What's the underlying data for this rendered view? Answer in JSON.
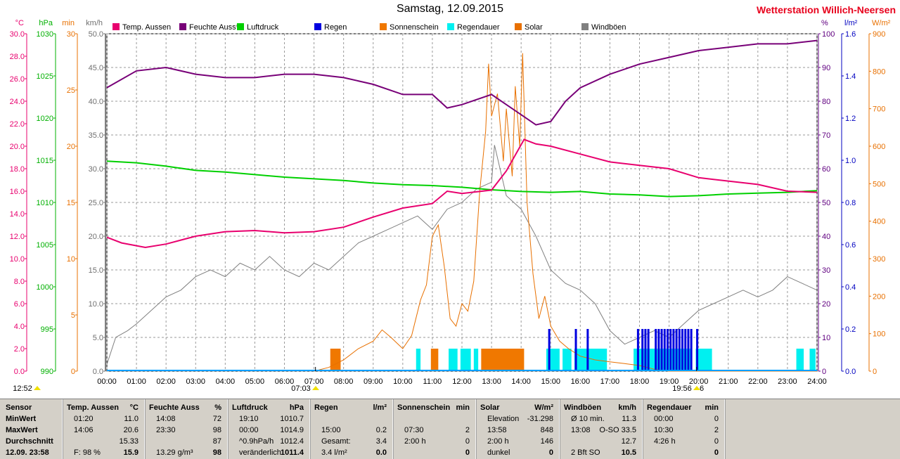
{
  "page": {
    "title": "Samstag, 12.09.2015",
    "station": "Wetterstation Willich-Neersen"
  },
  "chart_data": {
    "type": "line",
    "x_ticks": [
      "00:00",
      "01:00",
      "02:00",
      "03:00",
      "04:00",
      "05:00",
      "06:00",
      "07:00",
      "08:00",
      "09:00",
      "10:00",
      "11:00",
      "12:00",
      "13:00",
      "14:00",
      "15:00",
      "16:00",
      "17:00",
      "18:00",
      "19:00",
      "20:00",
      "21:00",
      "22:00",
      "23:00",
      "24:00"
    ],
    "x_range": [
      0,
      24
    ],
    "grid": true,
    "legend_placement": "top",
    "left_axes": [
      {
        "unit": "°C",
        "color": "#e8006e",
        "range": [
          0,
          30
        ],
        "ticks": [
          "0.0",
          "2.0",
          "4.0",
          "6.0",
          "8.0",
          "10.0",
          "12.0",
          "14.0",
          "16.0",
          "18.0",
          "20.0",
          "22.0",
          "24.0",
          "26.0",
          "28.0",
          "30.0"
        ]
      },
      {
        "unit": "hPa",
        "color": "#00b000",
        "range": [
          990,
          1030
        ],
        "ticks": [
          "990",
          "995",
          "1000",
          "1005",
          "1010",
          "1015",
          "1020",
          "1025",
          "1030"
        ]
      },
      {
        "unit": "min",
        "color": "#e87000",
        "range": [
          0,
          30
        ],
        "ticks": [
          "0",
          "5",
          "10",
          "15",
          "20",
          "25",
          "30"
        ]
      },
      {
        "unit": "km/h",
        "color": "#707070",
        "range": [
          0,
          50
        ],
        "ticks": [
          "0.0",
          "5.0",
          "10.0",
          "15.0",
          "20.0",
          "25.0",
          "30.0",
          "35.0",
          "40.0",
          "45.0",
          "50.0"
        ]
      }
    ],
    "right_axes": [
      {
        "unit": "%",
        "color": "#600080",
        "range": [
          0,
          100
        ],
        "ticks": [
          "0",
          "10",
          "20",
          "30",
          "40",
          "50",
          "60",
          "70",
          "80",
          "90",
          "100"
        ]
      },
      {
        "unit": "l/m²",
        "color": "#0000c0",
        "range": [
          0,
          1.6
        ],
        "ticks": [
          "0.0",
          "0.2",
          "0.4",
          "0.6",
          "0.8",
          "1.0",
          "1.2",
          "1.4",
          "1.6"
        ]
      },
      {
        "unit": "W/m²",
        "color": "#e87000",
        "range": [
          0,
          900
        ],
        "ticks": [
          "0",
          "100",
          "200",
          "300",
          "400",
          "500",
          "600",
          "700",
          "800",
          "900"
        ]
      }
    ],
    "series": [
      {
        "name": "Temp. Aussen",
        "color": "#e8006e",
        "axis": "°C",
        "points": [
          [
            0,
            11.9
          ],
          [
            0.5,
            11.4
          ],
          [
            1.3,
            11.0
          ],
          [
            2,
            11.3
          ],
          [
            3,
            12.0
          ],
          [
            4,
            12.4
          ],
          [
            5,
            12.5
          ],
          [
            6,
            12.3
          ],
          [
            7,
            12.4
          ],
          [
            8,
            12.8
          ],
          [
            9,
            13.7
          ],
          [
            10,
            14.5
          ],
          [
            11,
            14.9
          ],
          [
            11.5,
            16.0
          ],
          [
            12,
            15.8
          ],
          [
            13,
            16.1
          ],
          [
            13.5,
            17.8
          ],
          [
            14.1,
            20.6
          ],
          [
            14.5,
            20.2
          ],
          [
            15,
            20.0
          ],
          [
            16,
            19.3
          ],
          [
            17,
            18.6
          ],
          [
            18,
            18.3
          ],
          [
            19,
            18.0
          ],
          [
            20,
            17.2
          ],
          [
            21,
            16.9
          ],
          [
            22,
            16.6
          ],
          [
            23,
            16.0
          ],
          [
            24,
            15.9
          ]
        ]
      },
      {
        "name": "Feuchte Auss*",
        "color": "#780078",
        "axis": "%",
        "points": [
          [
            0,
            84
          ],
          [
            1,
            89
          ],
          [
            2,
            90
          ],
          [
            3,
            88
          ],
          [
            4,
            87
          ],
          [
            5,
            87
          ],
          [
            6,
            88
          ],
          [
            7,
            88
          ],
          [
            8,
            87
          ],
          [
            9,
            85
          ],
          [
            10,
            82
          ],
          [
            11,
            82
          ],
          [
            11.5,
            78
          ],
          [
            12,
            79
          ],
          [
            13,
            82
          ],
          [
            13.5,
            79
          ],
          [
            14,
            76
          ],
          [
            14.5,
            73
          ],
          [
            15,
            74
          ],
          [
            15.5,
            80
          ],
          [
            16,
            84
          ],
          [
            17,
            88
          ],
          [
            18,
            91
          ],
          [
            19,
            93
          ],
          [
            20,
            95
          ],
          [
            21,
            96
          ],
          [
            22,
            97
          ],
          [
            23,
            97
          ],
          [
            24,
            98
          ]
        ]
      },
      {
        "name": "Luftdruck",
        "color": "#00d000",
        "axis": "hPa",
        "points": [
          [
            0,
            1014.9
          ],
          [
            1,
            1014.7
          ],
          [
            2,
            1014.3
          ],
          [
            3,
            1013.8
          ],
          [
            4,
            1013.6
          ],
          [
            5,
            1013.3
          ],
          [
            6,
            1013.0
          ],
          [
            7,
            1012.8
          ],
          [
            8,
            1012.6
          ],
          [
            9,
            1012.3
          ],
          [
            10,
            1012.1
          ],
          [
            11,
            1012.0
          ],
          [
            12,
            1011.8
          ],
          [
            13,
            1011.5
          ],
          [
            14,
            1011.3
          ],
          [
            15,
            1011.2
          ],
          [
            16,
            1011.3
          ],
          [
            17,
            1011.0
          ],
          [
            18,
            1010.9
          ],
          [
            19,
            1010.7
          ],
          [
            20,
            1010.8
          ],
          [
            21,
            1011.0
          ],
          [
            22,
            1011.1
          ],
          [
            23,
            1011.2
          ],
          [
            24,
            1011.4
          ]
        ]
      },
      {
        "name": "Regen",
        "color": "#0000e0",
        "axis": "l/m²",
        "bars": [
          [
            14.95,
            0.2
          ],
          [
            15.85,
            0.2
          ],
          [
            16.25,
            0.2
          ],
          [
            17.95,
            0.2
          ],
          [
            18.1,
            0.2
          ],
          [
            18.2,
            0.2
          ],
          [
            18.3,
            0.2
          ],
          [
            18.55,
            0.2
          ],
          [
            18.65,
            0.2
          ],
          [
            18.75,
            0.2
          ],
          [
            18.85,
            0.2
          ],
          [
            18.95,
            0.2
          ],
          [
            19.05,
            0.2
          ],
          [
            19.15,
            0.2
          ],
          [
            19.25,
            0.2
          ],
          [
            19.35,
            0.2
          ],
          [
            19.45,
            0.2
          ],
          [
            19.55,
            0.2
          ],
          [
            19.65,
            0.2
          ],
          [
            19.75,
            0.2
          ],
          [
            19.95,
            0.2
          ]
        ]
      },
      {
        "name": "Sonnenschein",
        "color": "#f07800",
        "axis": "min",
        "bars": [
          [
            7.55,
            7.9,
            2
          ],
          [
            10.95,
            11.2,
            2
          ],
          [
            12.65,
            14.1,
            2
          ]
        ]
      },
      {
        "name": "Regendauer",
        "color": "#00f0f0",
        "axis": "min",
        "bars": [
          [
            10.45,
            10.6,
            2
          ],
          [
            11.55,
            11.85,
            2
          ],
          [
            11.95,
            12.3,
            2
          ],
          [
            12.4,
            12.55,
            2
          ],
          [
            14.85,
            15.3,
            2
          ],
          [
            15.4,
            15.7,
            2
          ],
          [
            15.8,
            16.9,
            2
          ],
          [
            17.8,
            19.75,
            2
          ],
          [
            19.9,
            20.45,
            2
          ],
          [
            23.3,
            23.55,
            2
          ],
          [
            23.75,
            23.95,
            2
          ]
        ]
      },
      {
        "name": "Solar",
        "color": "#e87000",
        "axis": "W/m²",
        "points": [
          [
            7.0,
            0
          ],
          [
            7.5,
            10
          ],
          [
            8.0,
            30
          ],
          [
            8.5,
            60
          ],
          [
            9.0,
            80
          ],
          [
            9.3,
            110
          ],
          [
            9.6,
            90
          ],
          [
            10.0,
            60
          ],
          [
            10.3,
            95
          ],
          [
            10.6,
            190
          ],
          [
            10.8,
            230
          ],
          [
            11.0,
            360
          ],
          [
            11.2,
            390
          ],
          [
            11.4,
            280
          ],
          [
            11.6,
            140
          ],
          [
            11.8,
            120
          ],
          [
            12.0,
            180
          ],
          [
            12.2,
            160
          ],
          [
            12.4,
            240
          ],
          [
            12.6,
            480
          ],
          [
            12.8,
            640
          ],
          [
            12.9,
            820
          ],
          [
            13.0,
            680
          ],
          [
            13.2,
            740
          ],
          [
            13.4,
            560
          ],
          [
            13.5,
            700
          ],
          [
            13.7,
            520
          ],
          [
            13.8,
            760
          ],
          [
            13.95,
            600
          ],
          [
            14.05,
            848
          ],
          [
            14.2,
            450
          ],
          [
            14.4,
            260
          ],
          [
            14.6,
            140
          ],
          [
            14.8,
            200
          ],
          [
            15.0,
            120
          ],
          [
            15.3,
            80
          ],
          [
            15.6,
            60
          ],
          [
            16.0,
            40
          ],
          [
            16.5,
            30
          ],
          [
            17.0,
            25
          ],
          [
            17.5,
            20
          ],
          [
            18.0,
            15
          ],
          [
            18.5,
            5
          ],
          [
            19.0,
            0
          ],
          [
            24,
            0
          ]
        ]
      },
      {
        "name": "Windböen",
        "color": "#808080",
        "axis": "km/h",
        "points": [
          [
            0,
            1
          ],
          [
            0.3,
            5
          ],
          [
            0.7,
            6
          ],
          [
            1,
            7
          ],
          [
            1.5,
            9
          ],
          [
            2,
            11
          ],
          [
            2.5,
            12
          ],
          [
            3,
            14
          ],
          [
            3.5,
            15
          ],
          [
            4,
            14
          ],
          [
            4.5,
            16
          ],
          [
            5,
            15
          ],
          [
            5.5,
            17
          ],
          [
            6,
            15
          ],
          [
            6.5,
            14
          ],
          [
            7,
            16
          ],
          [
            7.5,
            15
          ],
          [
            8,
            17
          ],
          [
            8.5,
            19
          ],
          [
            9,
            20
          ],
          [
            9.5,
            21
          ],
          [
            10,
            22
          ],
          [
            10.5,
            23
          ],
          [
            11,
            21
          ],
          [
            11.5,
            24
          ],
          [
            12,
            25
          ],
          [
            12.5,
            27
          ],
          [
            13,
            28
          ],
          [
            13.1,
            33.5
          ],
          [
            13.5,
            26
          ],
          [
            14,
            24
          ],
          [
            14.5,
            20
          ],
          [
            15,
            15
          ],
          [
            15.5,
            13
          ],
          [
            16,
            12
          ],
          [
            16.5,
            10
          ],
          [
            17,
            6
          ],
          [
            17.5,
            4
          ],
          [
            18,
            5
          ],
          [
            18.5,
            6
          ],
          [
            19,
            5
          ],
          [
            19.5,
            7
          ],
          [
            20,
            9
          ],
          [
            20.5,
            10
          ],
          [
            21,
            11
          ],
          [
            21.5,
            12
          ],
          [
            22,
            11
          ],
          [
            22.5,
            12
          ],
          [
            23,
            14
          ],
          [
            23.5,
            13
          ],
          [
            24,
            12
          ]
        ]
      }
    ],
    "markers": [
      {
        "label": "12:52",
        "x": 12.87
      },
      {
        "label": "07:03",
        "x": 7.05
      },
      {
        "label": "19:56",
        "x": 19.93
      },
      {
        "label": "6",
        "x": 20.2
      }
    ]
  },
  "stats": {
    "columns": [
      {
        "title": "Sensor",
        "rows": [
          "MinWert",
          "MaxWert",
          "Durchschnitt",
          "12.09. 23:58"
        ]
      },
      {
        "title": "Temp. Aussen",
        "unit": "°C",
        "rows": [
          [
            "01:20",
            "11.0"
          ],
          [
            "14:06",
            "20.6"
          ],
          [
            "",
            "15.33"
          ],
          [
            "F: 98 %",
            "15.9"
          ]
        ]
      },
      {
        "title": "Feuchte Auss",
        "unit": "%",
        "rows": [
          [
            "14:08",
            "72"
          ],
          [
            "23:30",
            "98"
          ],
          [
            "",
            "87"
          ],
          [
            "13.29 g/m³",
            "98"
          ]
        ]
      },
      {
        "title": "Luftdruck",
        "unit": "hPa",
        "rows": [
          [
            "19:10",
            "1010.7"
          ],
          [
            "00:00",
            "1014.9"
          ],
          [
            "^0.9hPa/h",
            "1012.4"
          ],
          [
            "veränderlich",
            "1011.4"
          ]
        ]
      },
      {
        "title": "Regen",
        "unit": "l/m²",
        "rows": [
          [
            "",
            ""
          ],
          [
            "15:00",
            "0.2"
          ],
          [
            "Gesamt:",
            "3.4"
          ],
          [
            "3.4 l/m²",
            "0.0"
          ]
        ]
      },
      {
        "title": "Sonnenschein",
        "unit": "min",
        "rows": [
          [
            "",
            ""
          ],
          [
            "07:30",
            "2"
          ],
          [
            "2:00 h",
            "0"
          ],
          [
            "",
            "0"
          ]
        ]
      },
      {
        "title": "Solar",
        "unit": "W/m²",
        "rows": [
          [
            "Elevation",
            "-31.298"
          ],
          [
            "13:58",
            "848"
          ],
          [
            "2:00 h",
            "146"
          ],
          [
            "dunkel",
            "0"
          ]
        ]
      },
      {
        "title": "Windböen",
        "unit": "km/h",
        "rows": [
          [
            "Ø 10 min.",
            "11.3"
          ],
          [
            "13:08",
            "O-SO 33.5"
          ],
          [
            "",
            "12.7"
          ],
          [
            "2 Bft SO",
            "10.5"
          ]
        ]
      },
      {
        "title": "Regendauer",
        "unit": "min",
        "rows": [
          [
            "00:00",
            "0"
          ],
          [
            "10:30",
            "2"
          ],
          [
            "4:26 h",
            "0"
          ],
          [
            "",
            "0"
          ]
        ]
      }
    ]
  }
}
